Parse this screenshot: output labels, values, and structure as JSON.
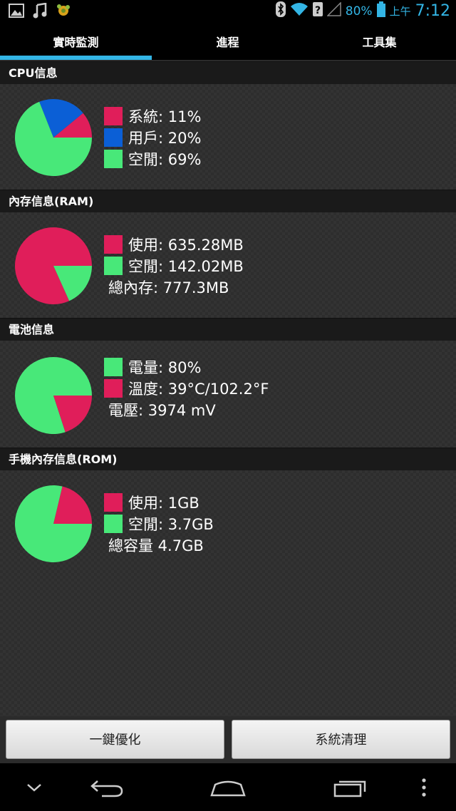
{
  "status": {
    "battery_percent": "80%",
    "ampm": "上午",
    "time": "7:12"
  },
  "tabs": [
    {
      "label": "實時監測",
      "active": true
    },
    {
      "label": "進程",
      "active": false
    },
    {
      "label": "工具集",
      "active": false
    }
  ],
  "colors": {
    "red": "#e01e5a",
    "blue": "#0b5fd6",
    "green": "#48e879",
    "accent": "#33b5e5"
  },
  "cpu": {
    "title": "CPU信息",
    "items": [
      {
        "label": "系統: 11%",
        "value": 11,
        "color": "#e01e5a"
      },
      {
        "label": "用戶: 20%",
        "value": 20,
        "color": "#0b5fd6"
      },
      {
        "label": "空閒: 69%",
        "value": 69,
        "color": "#48e879"
      }
    ]
  },
  "ram": {
    "title": "內存信息(RAM)",
    "items": [
      {
        "label": "使用: 635.28MB",
        "value": 635.28,
        "color": "#e01e5a"
      },
      {
        "label": "空閒: 142.02MB",
        "value": 142.02,
        "color": "#48e879"
      }
    ],
    "total": "總內存: 777.3MB"
  },
  "battery": {
    "title": "電池信息",
    "items": [
      {
        "label": "電量: 80%",
        "value": 80,
        "color": "#48e879"
      },
      {
        "label": "溫度: 39°C/102.2°F",
        "value": 20,
        "color": "#e01e5a"
      }
    ],
    "voltage": "電壓: 3974 mV"
  },
  "rom": {
    "title": "手機內存信息(ROM)",
    "items": [
      {
        "label": "使用: 1GB",
        "value": 1,
        "color": "#e01e5a"
      },
      {
        "label": "空閒: 3.7GB",
        "value": 3.7,
        "color": "#48e879"
      }
    ],
    "total": "總容量 4.7GB"
  },
  "buttons": {
    "optimize": "一鍵優化",
    "clean": "系統清理"
  }
}
